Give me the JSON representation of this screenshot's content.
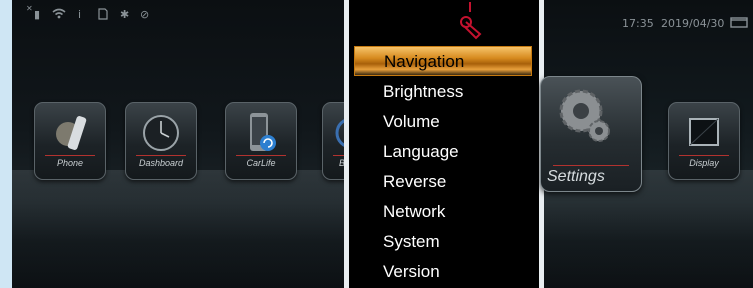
{
  "status_bar": {
    "time": "17:35",
    "date": "2019/04/30"
  },
  "apps_left": [
    {
      "label": "Phone",
      "icon": "phone-icon"
    },
    {
      "label": "Dashboard",
      "icon": "clock-icon"
    },
    {
      "label": "CarLife",
      "icon": "carlife-icon"
    },
    {
      "label": "B",
      "icon": "partial-app-icon"
    }
  ],
  "apps_right": [
    {
      "label": "Settings",
      "icon": "gear-icon"
    },
    {
      "label": "Display",
      "icon": "monitor-icon"
    }
  ],
  "menu": {
    "items": [
      {
        "label": "Navigation",
        "active": true
      },
      {
        "label": "Brightness"
      },
      {
        "label": "Volume"
      },
      {
        "label": "Language"
      },
      {
        "label": "Reverse"
      },
      {
        "label": "Network"
      },
      {
        "label": "System"
      },
      {
        "label": "Version"
      }
    ]
  },
  "colors": {
    "highlight": "#d68a1e",
    "accent_line": "#b2322f",
    "tap_indicator": "#c4122f"
  }
}
